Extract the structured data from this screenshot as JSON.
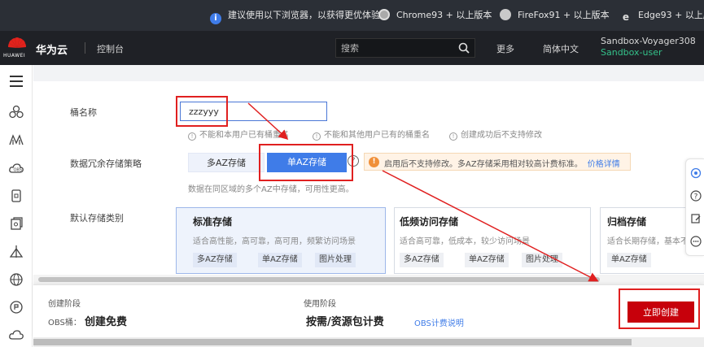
{
  "notice": {
    "message": "建议使用以下浏览器，以获得更优体验：",
    "browsers": [
      {
        "name": "Chrome93 + 以上版本",
        "icon": "chrome-icon"
      },
      {
        "name": "FireFox91 + 以上版本",
        "icon": "firefox-icon"
      },
      {
        "name": "Edge93 + 以上版本",
        "icon": "edge-icon"
      }
    ]
  },
  "header": {
    "logo_text": "HUAWEI",
    "brand": "华为云",
    "console": "控制台",
    "search_placeholder": "搜索",
    "more": "更多",
    "language": "简体中文",
    "account_name": "Sandbox-Voyager308",
    "account_user": "Sandbox-user"
  },
  "sidebar": {
    "icons": [
      "menu-icon",
      "cluster-icon",
      "mountain-icon",
      "cloud-icon",
      "database-icon",
      "storage-icon",
      "network-icon",
      "globe-icon",
      "security-icon",
      "cloud-service-icon"
    ]
  },
  "form": {
    "bucket_name_label": "桶名称",
    "bucket_name_value": "zzzyyy",
    "hints": [
      "不能和本用户已有桶重名",
      "不能和其他用户已有的桶重名",
      "创建成功后不支持修改"
    ],
    "redundancy_label": "数据冗余存储策略",
    "multi_az": "多AZ存储",
    "single_az": "单AZ存储",
    "warning": "启用后不支持修改。多AZ存储采用相对较高计费标准。",
    "warning_link": "价格详情",
    "redundancy_desc": "数据在同区域的多个AZ中存储，可用性更高。",
    "storage_class_label": "默认存储类别",
    "storage_classes": [
      {
        "title": "标准存储",
        "desc": "适合高性能，高可靠，高可用，频繁访问场景",
        "tags": [
          "多AZ存储",
          "单AZ存储",
          "图片处理"
        ]
      },
      {
        "title": "低频访问存储",
        "desc": "适合高可靠，低成本，较少访问场景",
        "tags": [
          "多AZ存储",
          "单AZ存储",
          "图片处理"
        ]
      },
      {
        "title": "归档存储",
        "desc": "适合长期存储，基本不",
        "tags": [
          "单AZ存储"
        ]
      }
    ]
  },
  "footer": {
    "create_stage": "创建阶段",
    "obs_bucket": "OBS桶：",
    "create_price": "创建免费",
    "use_stage": "使用阶段",
    "use_price": "按需/资源包计费",
    "billing_link": "OBS计费说明",
    "create_button": "立即创建"
  },
  "right_float": {
    "icons": [
      "customer-service-icon",
      "help-icon",
      "feedback-icon",
      "chat-icon"
    ]
  },
  "colors": {
    "primary": "#3f7ce8",
    "danger": "#c7000b",
    "annotation": "#e02020",
    "warning": "#f0903a"
  }
}
